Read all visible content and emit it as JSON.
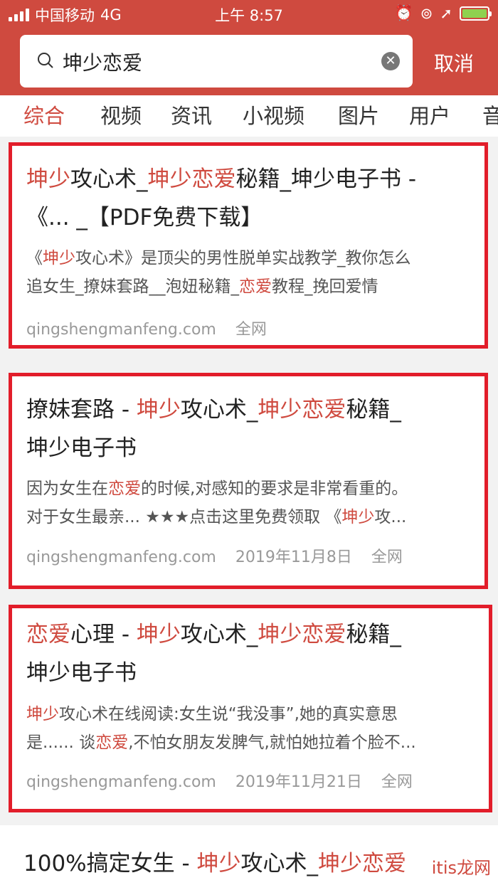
{
  "status": {
    "carrier": "中国移动",
    "network": "4G",
    "time": "上午 8:57"
  },
  "search": {
    "query": "坤少恋爱",
    "cancel_label": "取消"
  },
  "tabs": [
    {
      "label": "综合",
      "active": true
    },
    {
      "label": "视频"
    },
    {
      "label": "资讯"
    },
    {
      "label": "小视频"
    },
    {
      "label": "图片"
    },
    {
      "label": "用户"
    },
    {
      "label": "音"
    }
  ],
  "results": [
    {
      "title_l1": [
        {
          "t": "坤少",
          "hl": true
        },
        {
          "t": "攻心术_"
        },
        {
          "t": "坤少恋爱",
          "hl": true
        },
        {
          "t": "秘籍_坤少电子书 -"
        }
      ],
      "title_l2": [
        {
          "t": "《... _【PDF免费下载】"
        }
      ],
      "snippet_l1": [
        {
          "t": "《"
        },
        {
          "t": "坤少",
          "hl": true
        },
        {
          "t": "攻心术》是顶尖的男性脱单实战教学_教你怎么"
        }
      ],
      "snippet_l2": [
        {
          "t": "追女生_撩妹套路__泡妞秘籍_"
        },
        {
          "t": "恋爱",
          "hl": true
        },
        {
          "t": "教程_挽回爱情"
        }
      ],
      "domain": "qingshengmanfeng.com",
      "date": "",
      "source": "全网"
    },
    {
      "title_l1": [
        {
          "t": "撩妹套路 - "
        },
        {
          "t": "坤少",
          "hl": true
        },
        {
          "t": "攻心术_"
        },
        {
          "t": "坤少恋爱",
          "hl": true
        },
        {
          "t": "秘籍_"
        }
      ],
      "title_l2": [
        {
          "t": "坤少电子书"
        }
      ],
      "snippet_l1": [
        {
          "t": "因为女生在"
        },
        {
          "t": "恋爱",
          "hl": true
        },
        {
          "t": "的时候,对感知的要求是非常看重的。"
        }
      ],
      "snippet_l2": [
        {
          "t": "对于女生最亲... ★★★点击这里免费领取 《"
        },
        {
          "t": "坤少",
          "hl": true
        },
        {
          "t": "攻..."
        }
      ],
      "domain": "qingshengmanfeng.com",
      "date": "2019年11月8日",
      "source": "全网"
    },
    {
      "title_l1": [
        {
          "t": "恋爱",
          "hl": true
        },
        {
          "t": "心理 - "
        },
        {
          "t": "坤少",
          "hl": true
        },
        {
          "t": "攻心术_"
        },
        {
          "t": "坤少恋爱",
          "hl": true
        },
        {
          "t": "秘籍_"
        }
      ],
      "title_l2": [
        {
          "t": "坤少电子书"
        }
      ],
      "snippet_l1": [
        {
          "t": "坤少",
          "hl": true
        },
        {
          "t": "攻心术在线阅读:女生说“我没事”,她的真实意思"
        }
      ],
      "snippet_l2": [
        {
          "t": "是...... 谈"
        },
        {
          "t": "恋爱",
          "hl": true
        },
        {
          "t": ",不怕女朋友发脾气,就怕她拉着个脸不..."
        }
      ],
      "domain": "qingshengmanfeng.com",
      "date": "2019年11月21日",
      "source": "全网"
    }
  ],
  "partial_result": [
    {
      "t": "100%搞定女生 - "
    },
    {
      "t": "坤少",
      "hl": true
    },
    {
      "t": "攻心术_"
    },
    {
      "t": "坤少恋爱",
      "hl": true
    }
  ],
  "watermark": "itis龙网",
  "colors": {
    "accent": "#cf4a3f",
    "highlight_border": "#e21d2a"
  }
}
